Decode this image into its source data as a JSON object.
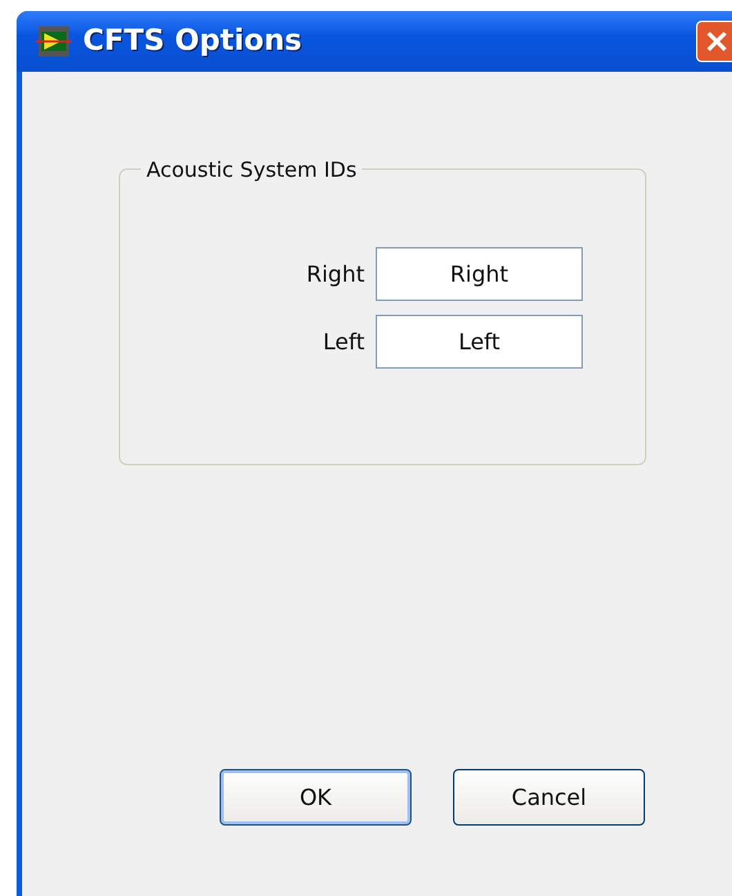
{
  "window": {
    "title": "CFTS Options"
  },
  "group": {
    "title": "Acoustic System IDs",
    "fields": [
      {
        "label": "Right",
        "value": "Right"
      },
      {
        "label": "Left",
        "value": "Left"
      }
    ]
  },
  "buttons": [
    {
      "label": "OK",
      "default": true
    },
    {
      "label": "Cancel",
      "default": false
    }
  ]
}
